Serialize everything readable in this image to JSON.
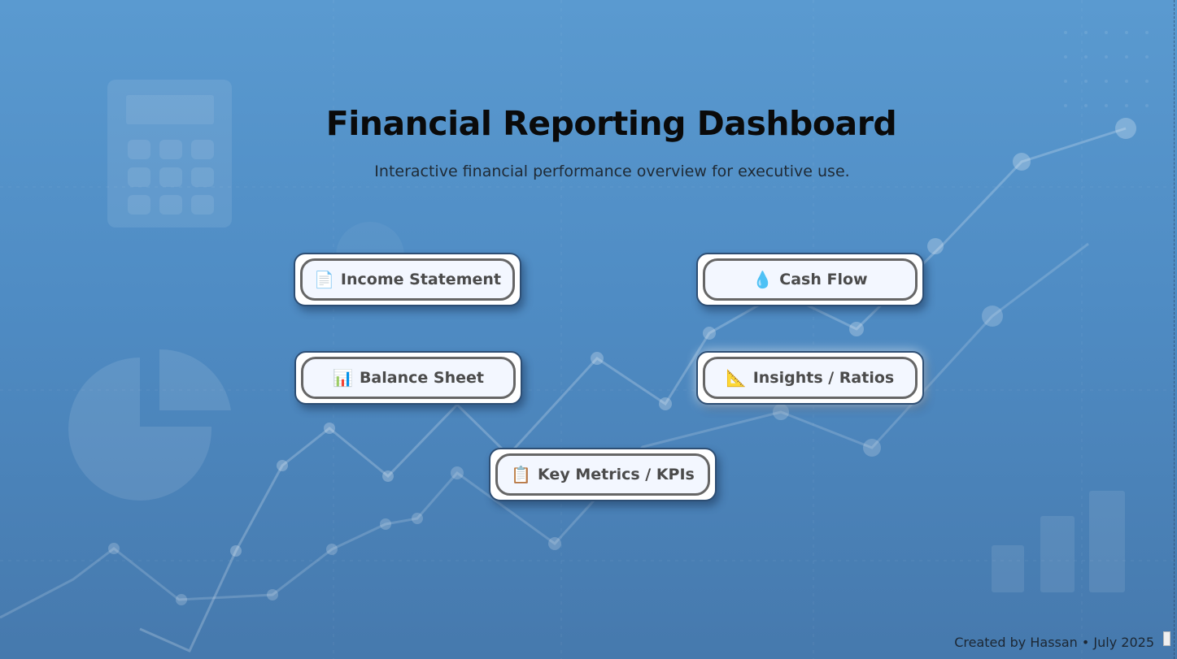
{
  "header": {
    "title": "Financial Reporting Dashboard",
    "subtitle": "Interactive financial performance overview for executive use."
  },
  "nav_buttons": [
    {
      "label": "Income Statement",
      "icon": "document-icon",
      "glyph": "📄"
    },
    {
      "label": "Cash Flow",
      "icon": "droplet-icon",
      "glyph": "💧"
    },
    {
      "label": "Balance Sheet",
      "icon": "bar-chart-icon",
      "glyph": "📊"
    },
    {
      "label": "Insights / Ratios",
      "icon": "triangle-ruler-icon",
      "glyph": "📐"
    },
    {
      "label": "Key Metrics / KPIs",
      "icon": "clipboard-icon",
      "glyph": "📋"
    }
  ],
  "footer": {
    "credit": "Created by Hassan • July 2025"
  },
  "colors": {
    "background_top": "#5a9ad0",
    "background_bottom": "#4679ad",
    "button_border": "#2d4e74",
    "button_fill": "#f3f7ff",
    "button_text": "#4b4b4b"
  }
}
